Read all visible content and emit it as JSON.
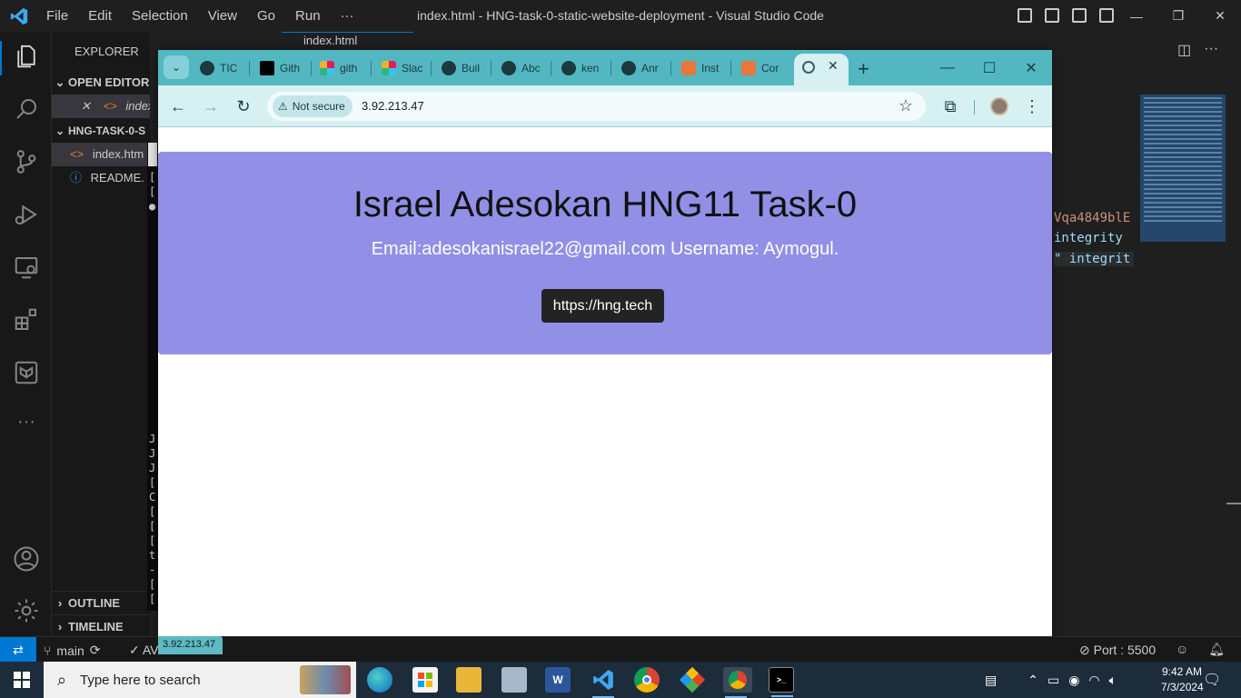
{
  "vscode": {
    "menu": [
      "File",
      "Edit",
      "Selection",
      "View",
      "Go",
      "Run",
      "···"
    ],
    "window_title": "index.html - HNG-task-0-static-website-deployment - Visual Studio Code",
    "editor_tab": "index.html",
    "sidebar": {
      "header": "EXPLORER",
      "open_editors": "OPEN EDITORS",
      "open_file": "index.htm",
      "folder": "HNG-TASK-0-S",
      "files": [
        "index.htm",
        "README."
      ],
      "outline": "OUTLINE",
      "timeline": "TIMELINE"
    },
    "terminal_chars": [
      "[",
      "[",
      "●",
      "J",
      "J",
      "J",
      "[",
      "C",
      "[",
      "[",
      "[",
      "t",
      "-",
      "[",
      "["
    ],
    "code_fragments": [
      "Vqa4849blE",
      "integrity",
      "\" integrit"
    ],
    "status": {
      "branch": "main",
      "check_text": "AV",
      "port": "Port : 5500"
    }
  },
  "browser": {
    "tabs": [
      {
        "label": "TIC",
        "icon": "github-icon"
      },
      {
        "label": "Gith",
        "icon": "github-icon"
      },
      {
        "label": "gith",
        "icon": "slack-icon"
      },
      {
        "label": "Slac",
        "icon": "slack-icon"
      },
      {
        "label": "Buil",
        "icon": "github-icon"
      },
      {
        "label": "Abc",
        "icon": "github-icon"
      },
      {
        "label": "ken",
        "icon": "github-icon"
      },
      {
        "label": "Anr",
        "icon": "github-icon"
      },
      {
        "label": "Inst",
        "icon": "aws-icon"
      },
      {
        "label": "Cor",
        "icon": "aws-icon"
      }
    ],
    "security_label": "Not secure",
    "url": "3.92.213.47",
    "status_tooltip": "3.92.213.47"
  },
  "page": {
    "title": "Israel Adesokan HNG11 Task-0",
    "subtitle": "Email:adesokanisrael22@gmail.com Username: Aymogul.",
    "link_label": "https://hng.tech"
  },
  "taskbar": {
    "search_placeholder": "Type here to search",
    "time": "9:42 AM",
    "date": "7/3/2024"
  },
  "colors": {
    "hero_bg": "#9190e6",
    "chrome_frame": "#53b7c2",
    "vscode_accent": "#0078d4"
  }
}
